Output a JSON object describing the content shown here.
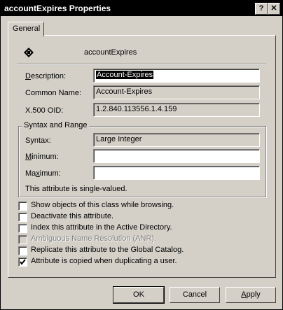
{
  "window": {
    "title": "accountExpires Properties",
    "help_label": "?",
    "close_label": "✕"
  },
  "tab": {
    "label": "General"
  },
  "header": {
    "name": "accountExpires",
    "icon": "attribute-icon"
  },
  "fields": {
    "description": {
      "label": "Description:",
      "value": "Account-Expires"
    },
    "common_name": {
      "label": "Common Name:",
      "value": "Account-Expires"
    },
    "oid": {
      "label": "X.500 OID:",
      "value": "1.2.840.113556.1.4.159"
    }
  },
  "syntax_group": {
    "title": "Syntax and Range",
    "syntax": {
      "label": "Syntax:",
      "value": "Large Integer"
    },
    "minimum": {
      "label": "Minimum:",
      "value": ""
    },
    "maximum": {
      "label": "Maximum:",
      "value": ""
    },
    "note": "This attribute is single-valued."
  },
  "checkboxes": [
    {
      "label": "Show objects of this class while browsing.",
      "checked": false,
      "enabled": true
    },
    {
      "label": "Deactivate this attribute.",
      "checked": false,
      "enabled": true
    },
    {
      "label": "Index this attribute in the Active Directory.",
      "checked": false,
      "enabled": true
    },
    {
      "label": "Ambiguous Name Resolution (ANR).",
      "checked": false,
      "enabled": false
    },
    {
      "label": "Replicate this attribute to the Global Catalog.",
      "checked": false,
      "enabled": true
    },
    {
      "label": "Attribute is copied when duplicating a user.",
      "checked": true,
      "enabled": true
    }
  ],
  "buttons": {
    "ok": "OK",
    "cancel": "Cancel",
    "apply": "Apply"
  }
}
